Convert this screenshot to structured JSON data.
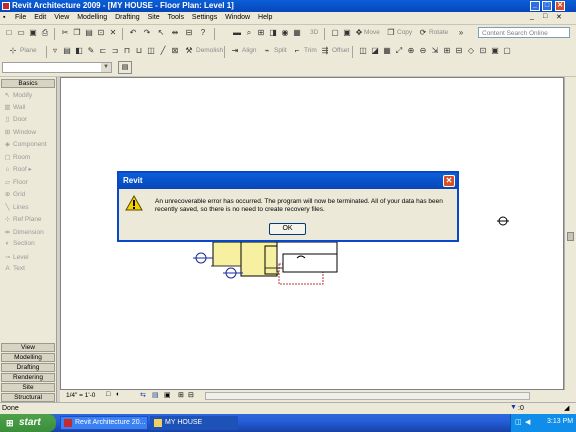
{
  "app": {
    "window_title": "Revit Architecture 2009 - [MY HOUSE - Floor Plan: Level 1]",
    "window_buttons": [
      "_",
      "□",
      "✕"
    ],
    "child_buttons": [
      "_",
      "□",
      "✕"
    ]
  },
  "menu": [
    "File",
    "Edit",
    "View",
    "Modelling",
    "Drafting",
    "Site",
    "Tools",
    "Settings",
    "Window",
    "Help"
  ],
  "toolbar2": {
    "move": "Move",
    "copy": "Copy",
    "rotate": "Rotate",
    "search_placeholder": "Content Search Online"
  },
  "toolbar3": {
    "plane": "Plane",
    "demolish": "Demolish",
    "align": "Align",
    "split": "Split",
    "trim": "Trim",
    "offset": "Offset"
  },
  "sidebar": {
    "basics": "Basics",
    "tools": [
      "Modify",
      "Wall",
      "Door",
      "Window",
      "Component",
      "Room",
      "Roof",
      "Floor",
      "Grid",
      "Lines",
      "Ref Plane",
      "Dimension",
      "Section",
      "Level",
      "Text"
    ],
    "tabs": [
      "View",
      "Modelling",
      "Drafting",
      "Rendering",
      "Site",
      "Structural"
    ]
  },
  "viewctl": {
    "scale": "1/4\" = 1'-0"
  },
  "status": {
    "text": "Done",
    "filter": ":0"
  },
  "taskbar": {
    "start": "start",
    "tasks": [
      "Revit Architecture 20...",
      "MY HOUSE"
    ],
    "clock": "3:13 PM"
  },
  "dialog": {
    "title": "Revit",
    "message": "An unrecoverable error has occurred.  The program will now be terminated.  All of your data has been recently saved, so there is no need to create recovery files.",
    "ok": "OK"
  },
  "colors": {
    "xp_blue": "#0a5fd8",
    "room_fill": "#f7f0a0",
    "taskbar": "#245edb",
    "start_green": "#3c8e3a"
  }
}
